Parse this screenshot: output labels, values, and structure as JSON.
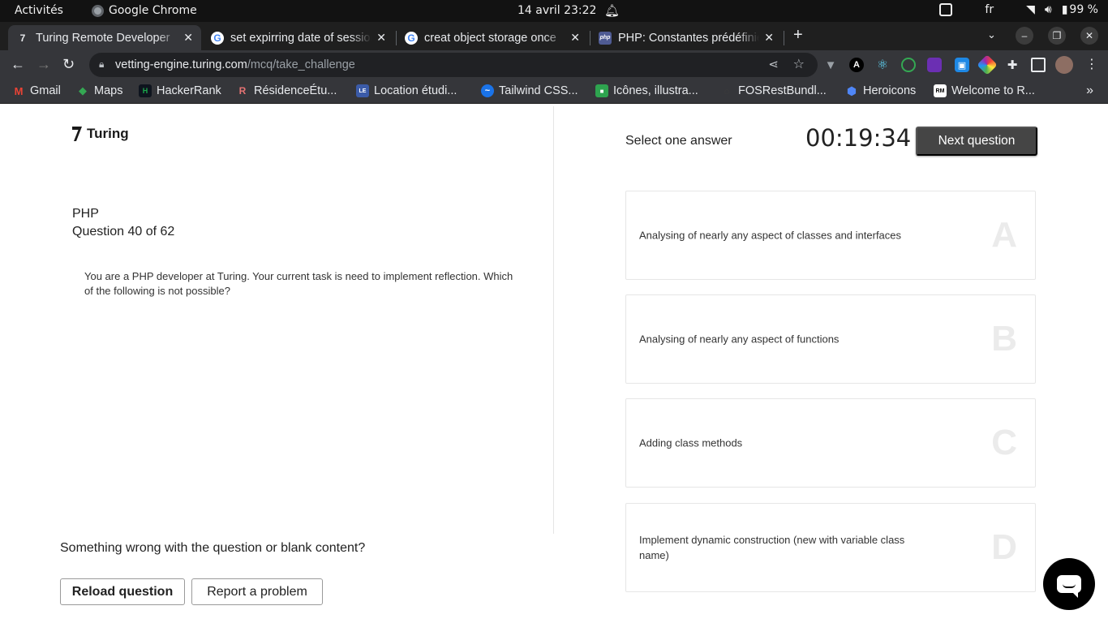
{
  "system_bar": {
    "activities": "Activités",
    "app_name": "Google Chrome",
    "clock": "14 avril  23:22",
    "keyboard_layout": "fr",
    "battery": "99 %"
  },
  "tabs": [
    {
      "title": "Turing Remote Developer",
      "icon": "turing-icon",
      "active": true
    },
    {
      "title": "set expirring date of session",
      "icon": "google-icon",
      "active": false
    },
    {
      "title": "creat object storage once",
      "icon": "google-icon",
      "active": false
    },
    {
      "title": "PHP: Constantes prédéfinies",
      "icon": "php-icon",
      "active": false
    }
  ],
  "address_bar": {
    "host": "vetting-engine.turing.com",
    "path": "/mcq/take_challenge"
  },
  "extensions": {
    "badge_count": "13"
  },
  "bookmarks": [
    {
      "label": "Gmail",
      "color": "#ea4335",
      "glyph": "M"
    },
    {
      "label": "Maps",
      "color": "#34a853",
      "glyph": "◆"
    },
    {
      "label": "HackerRank",
      "color": "#1ba94c",
      "glyph": "H"
    },
    {
      "label": "RésidenceÉtu...",
      "color": "#e57373",
      "glyph": "R"
    },
    {
      "label": "Location étudi...",
      "color": "#3b5ba8",
      "glyph": "LE"
    },
    {
      "label": "Tailwind CSS...",
      "color": "#1a73e8",
      "glyph": "~"
    },
    {
      "label": "Icônes, illustra...",
      "color": "#2ea44f",
      "glyph": "■"
    },
    {
      "label": "FOSRestBundl...",
      "color": "#1f1f1f",
      "glyph": "○"
    },
    {
      "label": "Heroicons",
      "color": "#4f86f7",
      "glyph": "⬢"
    },
    {
      "label": "Welcome to R...",
      "color": "#ffffff",
      "glyph": "RM"
    }
  ],
  "brand": {
    "name": "Turing"
  },
  "question": {
    "subject": "PHP",
    "counter": "Question 40 of 62",
    "text": "You are a PHP developer at Turing. Your current task is need to implement reflection. Which of the following is not possible?"
  },
  "feedback": {
    "prompt": "Something wrong with the question or blank content?",
    "reload_label": "Reload question",
    "report_label": "Report a problem"
  },
  "answer_panel": {
    "instruction": "Select one answer",
    "timer": "00:19:34",
    "next_label": "Next question",
    "options": [
      {
        "letter": "A",
        "text": "Analysing of nearly any aspect of classes and interfaces"
      },
      {
        "letter": "B",
        "text": "Analysing of nearly any aspect of functions"
      },
      {
        "letter": "C",
        "text": "Adding class methods"
      },
      {
        "letter": "D",
        "text": "Implement dynamic construction (new with variable class name)"
      }
    ]
  }
}
